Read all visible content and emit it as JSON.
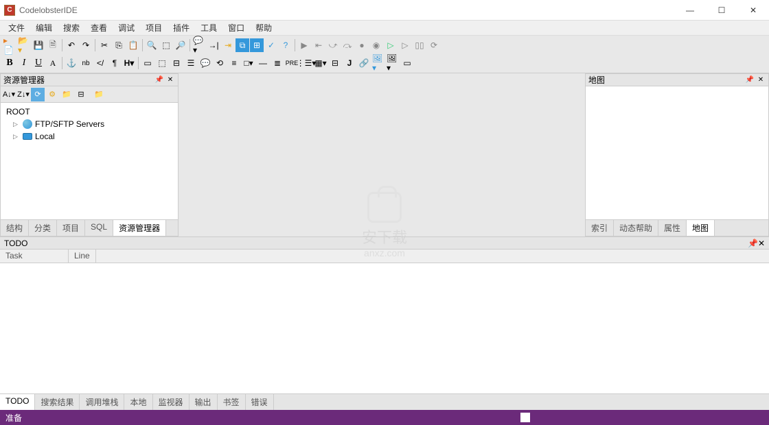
{
  "title": "CodelobsterIDE",
  "menu": [
    "文件",
    "编辑",
    "搜索",
    "查看",
    "调试",
    "项目",
    "插件",
    "工具",
    "窗口",
    "帮助"
  ],
  "left_panel": {
    "title": "资源管理器",
    "root": "ROOT",
    "items": [
      {
        "label": "FTP/SFTP Servers",
        "icon": "globe"
      },
      {
        "label": "Local",
        "icon": "monitor"
      }
    ],
    "tabs": [
      "结构",
      "分类",
      "项目",
      "SQL",
      "资源管理器"
    ],
    "active_tab": 4
  },
  "right_panel": {
    "title": "地图",
    "tabs": [
      "索引",
      "动态帮助",
      "属性",
      "地图"
    ],
    "active_tab": 3
  },
  "todo_panel": {
    "title": "TODO",
    "columns": [
      "Task",
      "Line"
    ],
    "tabs": [
      "TODO",
      "搜索结果",
      "调用堆栈",
      "本地",
      "监视器",
      "输出",
      "书签",
      "错误"
    ],
    "active_tab": 0
  },
  "status": "准备",
  "watermark": {
    "line1": "安下载",
    "line2": "anxz.com"
  }
}
